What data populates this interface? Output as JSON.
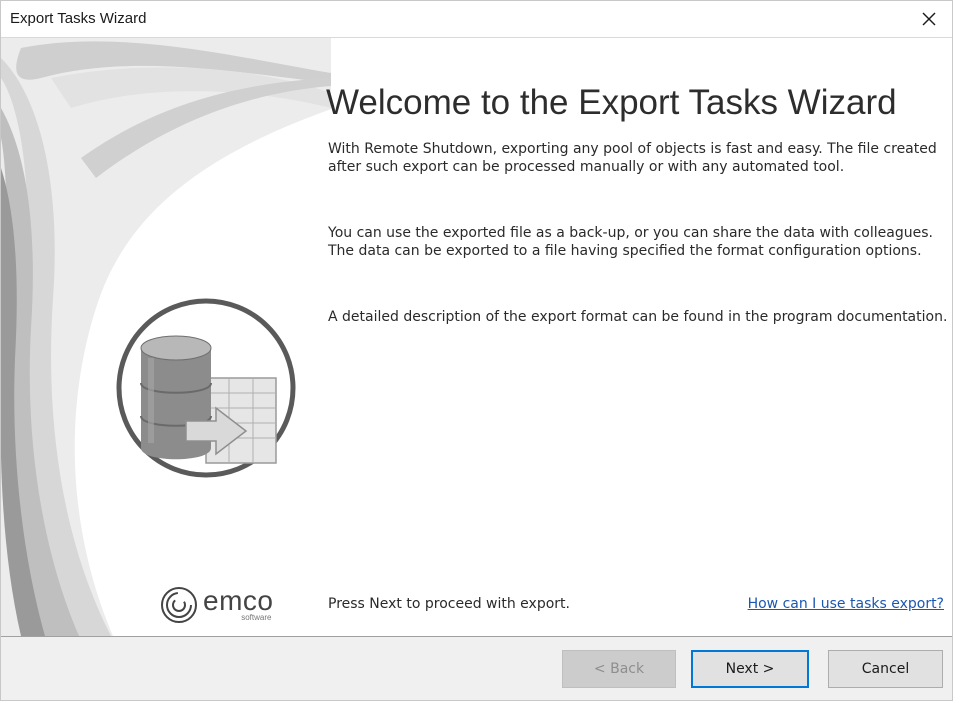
{
  "window": {
    "title": "Export Tasks Wizard",
    "close_icon": "close-icon"
  },
  "welcome": {
    "heading": "Welcome to the Export Tasks Wizard",
    "paragraphs": [
      "With Remote Shutdown, exporting any pool of objects is fast and easy. The file created after such export can be processed manually or with any automated tool.",
      "You can use the exported file as a back-up, or you can share the data with colleagues. The data can be exported to a file having specified the format configuration options.",
      "A detailed description of the export format can be found in the program documentation."
    ],
    "press_next": "Press Next to proceed with export.",
    "help_link": "How can I use tasks export?"
  },
  "logo": {
    "word": "emco",
    "sub": "software",
    "icon": "emco-logo-icon"
  },
  "artwork": {
    "icon": "database-export-icon"
  },
  "footer": {
    "back_label": "< Back",
    "back_enabled": false,
    "next_label": "Next >",
    "cancel_label": "Cancel"
  },
  "colors": {
    "link": "#1b57b0",
    "focus_border": "#0078d7",
    "footer_bg": "#f0f0f0"
  }
}
